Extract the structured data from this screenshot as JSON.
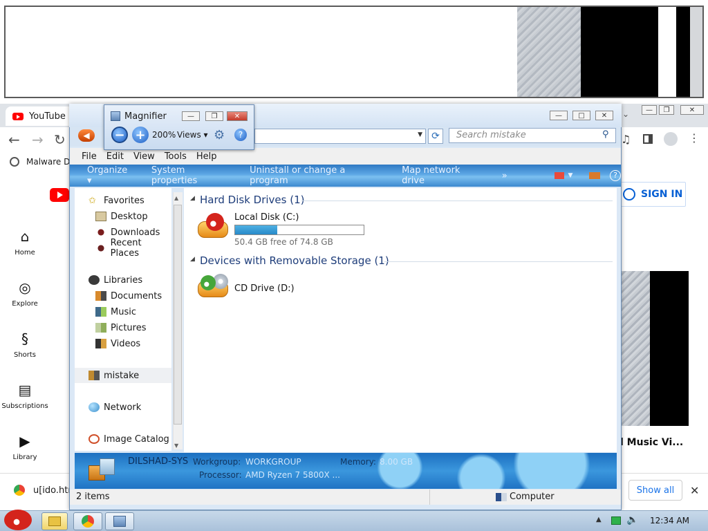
{
  "browser": {
    "tab_title": "YouTube",
    "bookmark": "Malware D",
    "signin": "SIGN IN",
    "video_title": "l Music Vi...",
    "sidebar": [
      {
        "label": "Home",
        "icon": "home-icon"
      },
      {
        "label": "Explore",
        "icon": "compass-icon"
      },
      {
        "label": "Shorts",
        "icon": "shorts-icon"
      },
      {
        "label": "Subscriptions",
        "icon": "subscriptions-icon"
      },
      {
        "label": "Library",
        "icon": "library-icon"
      }
    ],
    "download_name": "u[ido.htr",
    "show_all": "Show all"
  },
  "magnifier": {
    "title": "Magnifier",
    "zoom": "200%",
    "views": "Views"
  },
  "explorer": {
    "search_placeholder": "Search mistake",
    "menu": [
      "File",
      "Edit",
      "View",
      "Tools",
      "Help"
    ],
    "commands": [
      "Organize",
      "System properties",
      "Uninstall or change a program",
      "Map network drive",
      "»"
    ],
    "nav": {
      "favorites": "Favorites",
      "desktop": "Desktop",
      "downloads": "Downloads",
      "recent": "Recent Places",
      "libraries": "Libraries",
      "documents": "Documents",
      "music": "Music",
      "pictures": "Pictures",
      "videos": "Videos",
      "computer": "mistake",
      "network": "Network",
      "catalog": "Image Catalog"
    },
    "groups": {
      "hdd": "Hard Disk Drives (1)",
      "removable": "Devices with Removable Storage (1)"
    },
    "drives": {
      "c_name": "Local Disk (C:)",
      "c_free": "50.4 GB free of 74.8 GB",
      "c_used_fraction": 0.326,
      "d_name": "CD Drive (D:)"
    },
    "details": {
      "pc_name": "DILSHAD-SYS",
      "workgroup_label": "Workgroup:",
      "workgroup": "WORKGROUP",
      "memory_label": "Memory:",
      "memory": "8.00 GB",
      "processor_label": "Processor:",
      "processor": "AMD Ryzen 7 5800X ..."
    },
    "status": {
      "items": "2 items",
      "location": "Computer"
    }
  },
  "taskbar": {
    "clock": "12:34 AM"
  }
}
